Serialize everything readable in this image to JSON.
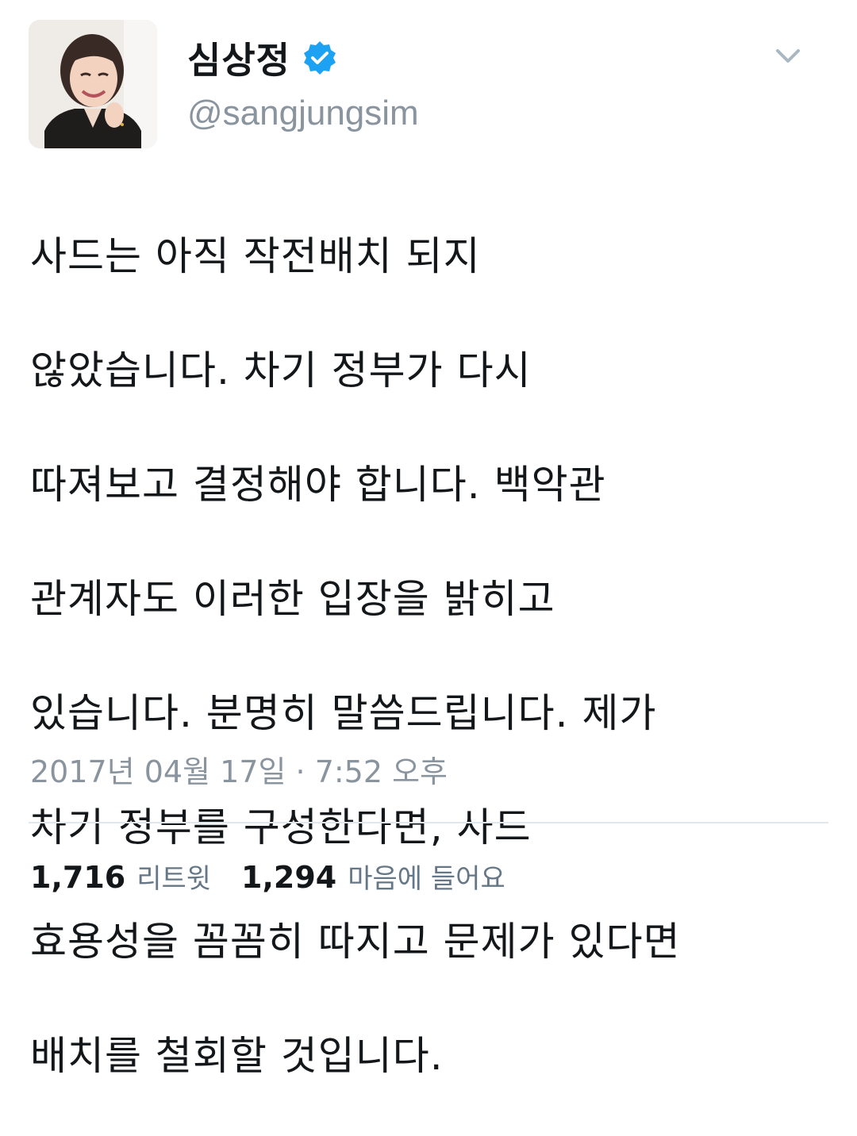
{
  "author": {
    "display_name": "심상정",
    "handle": "@sangjungsim",
    "verified": true
  },
  "tweet": {
    "lines": [
      "사드는 아직 작전배치 되지",
      "않았습니다. 차기 정부가 다시",
      "따져보고 결정해야 합니다. 백악관",
      "관계자도 이러한 입장을 밝히고",
      "있습니다. 분명히 말씀드립니다. 제가",
      "차기 정부를 구성한다면, 사드",
      "효용성을 꼼꼼히 따지고 문제가 있다면",
      "배치를 철회할 것입니다."
    ],
    "timestamp": "2017년 04월 17일 · 7:52 오후"
  },
  "stats": {
    "retweets_count": "1,716",
    "retweets_label": "리트윗",
    "likes_count": "1,294",
    "likes_label": "마음에 들어요"
  },
  "icons": {
    "verified": "verified-badge-icon",
    "menu": "chevron-down-icon"
  },
  "colors": {
    "verified_blue": "#1da1f2",
    "secondary_text": "#8a949e",
    "divider": "#e1e8ed"
  }
}
